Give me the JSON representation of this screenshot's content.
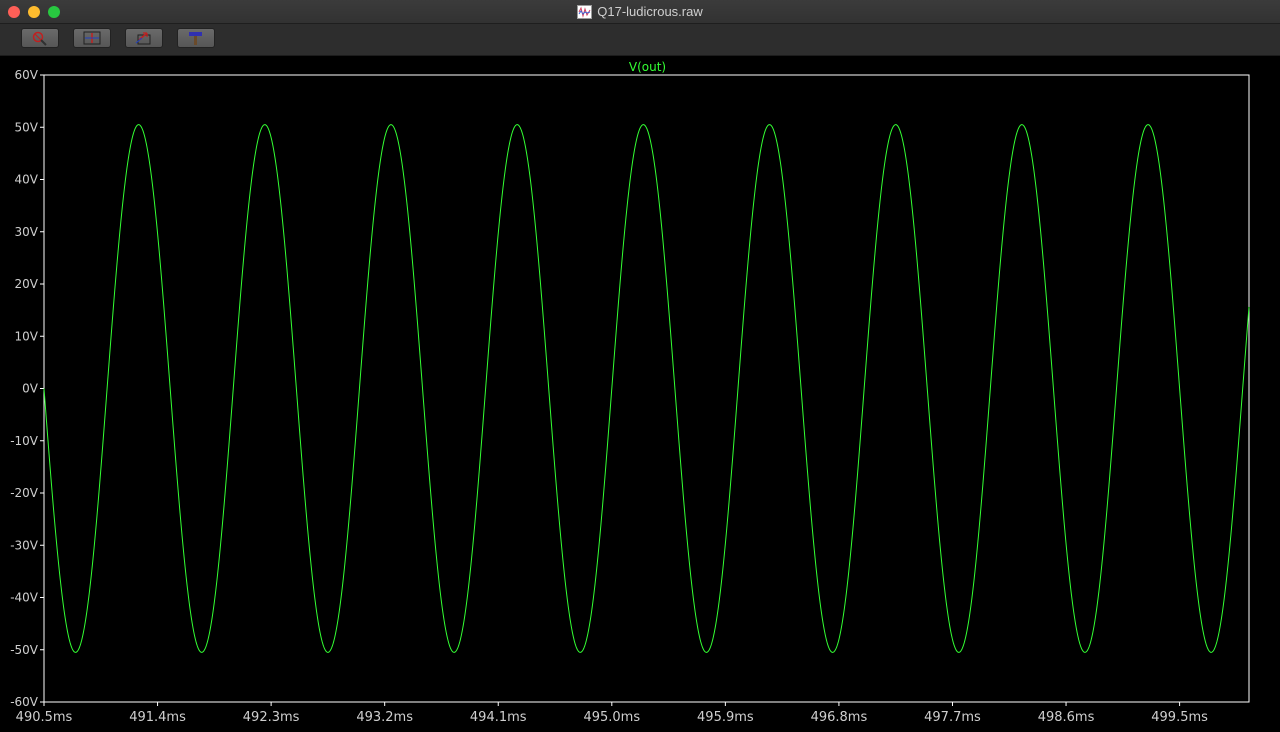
{
  "window": {
    "title": "Q17-ludicrous.raw"
  },
  "toolbar": {
    "buttons": [
      {
        "name": "zoom-tool-button",
        "icon": "magnifier-cross-icon"
      },
      {
        "name": "zoom-full-extent-button",
        "icon": "zoom-extents-icon"
      },
      {
        "name": "zoom-back-button",
        "icon": "zoom-back-icon"
      },
      {
        "name": "autorange-button",
        "icon": "hammer-icon"
      }
    ]
  },
  "colors": {
    "trace": "#33ff33",
    "frame": "#ffffff",
    "tick_label": "#cfcfcf",
    "background": "#000000"
  },
  "chart_data": {
    "type": "line",
    "title": "V(out)",
    "xlabel": "",
    "ylabel": "",
    "x_unit": "ms",
    "y_unit": "V",
    "xlim": [
      490.5,
      500.05
    ],
    "ylim": [
      -60,
      60
    ],
    "x_ticks": [
      "490.5ms",
      "491.4ms",
      "492.3ms",
      "493.2ms",
      "494.1ms",
      "495.0ms",
      "495.9ms",
      "496.8ms",
      "497.7ms",
      "498.6ms",
      "499.5ms"
    ],
    "y_ticks": [
      "60V",
      "50V",
      "40V",
      "30V",
      "20V",
      "10V",
      "0V",
      "-10V",
      "-20V",
      "-30V",
      "-40V",
      "-50V",
      "-60V"
    ],
    "grid": false,
    "series": [
      {
        "name": "V(out)",
        "waveform": "sine",
        "amplitude": 50.5,
        "offset": 0,
        "frequency_hz": 1000,
        "phase_deg": 180,
        "t_start": 490.5,
        "t_end": 500.05
      }
    ]
  }
}
